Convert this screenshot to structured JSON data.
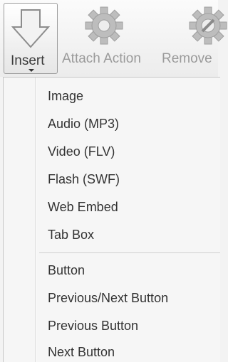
{
  "ribbon": {
    "insert_label": "Insert",
    "attach_label": "Attach Action",
    "remove_label": "Remove"
  },
  "menu": {
    "items": [
      "Image",
      "Audio (MP3)",
      "Video (FLV)",
      "Flash (SWF)",
      "Web Embed",
      "Tab Box",
      "Button",
      "Previous/Next Button",
      "Previous Button",
      "Next Button"
    ]
  },
  "icons": {
    "insert": "down-arrow-icon",
    "attach": "gear-icon",
    "remove": "gear-remove-icon"
  }
}
